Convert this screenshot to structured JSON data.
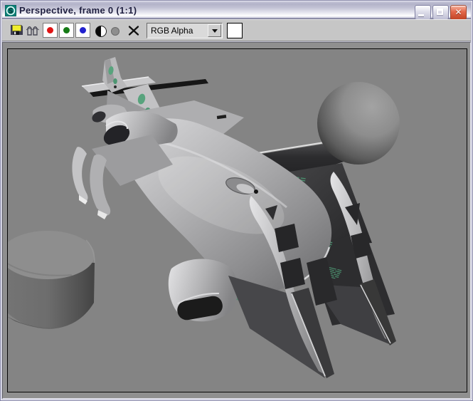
{
  "window": {
    "title": "Perspective, frame 0 (1:1)",
    "icon": "3ds-max-logo-icon",
    "buttons": {
      "minimize": "minimize",
      "maximize": "maximize",
      "close": "close"
    }
  },
  "toolbar": {
    "save_icon": "save-bitmap-icon",
    "clone_icon": "clone-rendered-frame-icon",
    "channel_buttons": [
      {
        "name": "red-channel",
        "color": "#e01414",
        "enabled": true
      },
      {
        "name": "green-channel",
        "color": "#157a15",
        "enabled": true
      },
      {
        "name": "blue-channel",
        "color": "#2222cf",
        "enabled": true
      }
    ],
    "alpha_icon": "alpha-channel-icon",
    "mono_icon": "monochrome-channel-icon",
    "clear_icon": "clear-x-icon",
    "display_dropdown": {
      "value": "RGB Alpha"
    },
    "swatch_color": "#ffffff"
  },
  "viewport": {
    "background_color": "#848484",
    "scene_objects": [
      "spaceship model",
      "sphere",
      "cylinder"
    ],
    "decal_color": "#4a8f6d"
  }
}
